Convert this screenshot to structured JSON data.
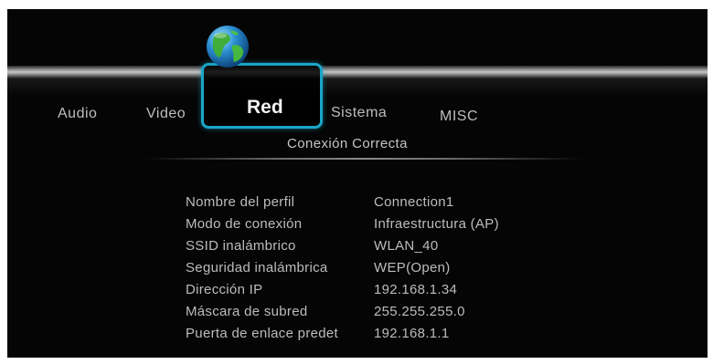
{
  "menu": {
    "tabs": [
      "Audio",
      "Video",
      "Red",
      "Sistema",
      "MISC"
    ],
    "selected_tab": "Red",
    "accent_color": "#1aa6c8"
  },
  "status": {
    "text": "Conexión Correcta"
  },
  "network_info": [
    {
      "label": "Nombre del perfil",
      "value": "Connection1"
    },
    {
      "label": "Modo de conexión",
      "value": "Infraestructura (AP)"
    },
    {
      "label": "SSID inalámbrico",
      "value": "WLAN_40"
    },
    {
      "label": "Seguridad inalámbrica",
      "value": "WEP(Open)"
    },
    {
      "label": "Dirección IP",
      "value": "192.168.1.34"
    },
    {
      "label": "Máscara de subred",
      "value": "255.255.255.0"
    },
    {
      "label": "Puerta de enlace predet",
      "value": "192.168.1.1"
    }
  ],
  "icons": {
    "selected_tab_icon": "globe-icon"
  }
}
